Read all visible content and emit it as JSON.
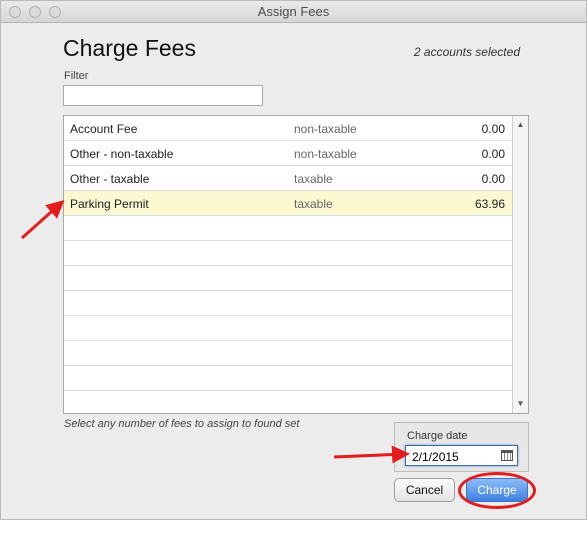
{
  "window": {
    "title": "Assign Fees"
  },
  "header": {
    "title": "Charge Fees",
    "selected_count": "2 accounts selected"
  },
  "filter": {
    "label": "Filter",
    "value": "",
    "placeholder": ""
  },
  "fees": [
    {
      "name": "Account Fee",
      "tax": "non-taxable",
      "amount": "0.00",
      "selected": false
    },
    {
      "name": "Other - non-taxable",
      "tax": "non-taxable",
      "amount": "0.00",
      "selected": false
    },
    {
      "name": "Other - taxable",
      "tax": "taxable",
      "amount": "0.00",
      "selected": false
    },
    {
      "name": "Parking Permit",
      "tax": "taxable",
      "amount": "63.96",
      "selected": true
    }
  ],
  "empty_rows": 8,
  "hint": "Select any number of fees to assign to found set",
  "charge_date": {
    "label": "Charge date",
    "value": "2/1/2015"
  },
  "buttons": {
    "cancel": "Cancel",
    "charge": "Charge"
  },
  "scroll": {
    "up": "▲",
    "down": "▼"
  },
  "colors": {
    "selected_row": "#fcf8d2",
    "annotation": "#e31c1c",
    "primary_button": "#3d7fe0"
  },
  "icons": {
    "date_picker": "calendar-icon"
  }
}
